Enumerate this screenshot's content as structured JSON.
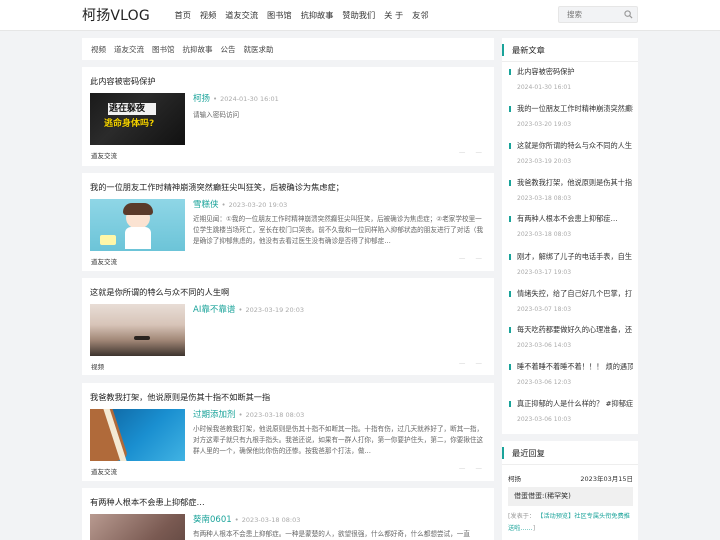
{
  "site": {
    "logo": "柯扬VLOG"
  },
  "nav": [
    "首页",
    "视频",
    "道友交流",
    "图书馆",
    "抗抑故事",
    "赞助我们",
    "关 于",
    "友邻"
  ],
  "search": {
    "placeholder": "搜索",
    "icon": "search-icon"
  },
  "categories": [
    "视频",
    "道友交流",
    "图书馆",
    "抗抑故事",
    "公告",
    "就医求助"
  ],
  "posts": [
    {
      "title": "此内容被密码保护",
      "author": "柯扬",
      "date": "2024-01-30 16:01",
      "excerpt": "请输入密码访问",
      "category": "道友交流",
      "thumb_text": [
        "逃在躲夜",
        "逃命身体吗?"
      ]
    },
    {
      "title": "我的一位朋友工作时精神崩溃突然癫狂尖叫狂笑，后被确诊为焦虑症；",
      "author": "雪糕侠",
      "date": "2023-03-20 19:03",
      "excerpt": "近期见闻：①我的一位朋友工作时精神崩溃突然癫狂尖叫狂笑，后被确诊为焦虑症；②老家学校里一位学生跳楼当场死亡，室长在校门口哭丧。前不久我和一位同样陷入抑郁状态的朋友进行了对话（我是确诊了抑郁焦虑的，他没有去看过医生没有确诊是否得了抑郁症…",
      "category": "道友交流"
    },
    {
      "title": "这就是你所谓的特么与众不同的人生啊",
      "author": "AI靠不靠谱",
      "date": "2023-03-19 20:03",
      "excerpt": "",
      "category": "视频"
    },
    {
      "title": "我爸教我打架，他说原则是伤其十指不如断其一指",
      "author": "过期添加剂",
      "date": "2023-03-18 08:03",
      "excerpt": "小时候我爸教我打架，他说原则是伤其十指不如断其一指。十指有伤，过几天就养好了，断其一指，对方这辈子就只有九根手指头。我爸还说，如果有一群人打你，第一你要护住头，第二，你要揪住这群人里的一个，确保他比你伤的还惨。按我爸那个打法，做…",
      "category": "道友交流"
    },
    {
      "title": "有两种人根本不会患上抑郁症…",
      "author": "葵南0601",
      "date": "2023-03-18 08:03",
      "excerpt": "有两种人根本不会患上抑郁症。一种是蒙楚的人，欲望很强，什么都好奇，什么都想尝试，一直",
      "category": ""
    }
  ],
  "sidebar": {
    "latest_title": "最新文章",
    "latest": [
      {
        "title": "此内容被密码保护",
        "date": "2024-01-30 16:01"
      },
      {
        "title": "我的一位朋友工作时精神崩溃突然癫狂",
        "date": "2023-03-20 19:03"
      },
      {
        "title": "这就是你所谓的特么与众不同的人生",
        "date": "2023-03-19 20:03"
      },
      {
        "title": "我爸教我打架，他说原则是伤其十指",
        "date": "2023-03-18 08:03"
      },
      {
        "title": "有两种人根本不会患上抑郁症…",
        "date": "2023-03-18 08:03"
      },
      {
        "title": "刚才，解绑了儿子的电话手表，自生",
        "date": "2023-03-17 19:03"
      },
      {
        "title": "情绪失控，给了自己好几个巴掌，打",
        "date": "2023-03-07 18:03"
      },
      {
        "title": "每天吃药都要做好久的心理准备，还",
        "date": "2023-03-06 14:03"
      },
      {
        "title": "睡不着睡不着睡不着！！！ 烦的遇顶",
        "date": "2023-03-06 12:03"
      },
      {
        "title": "真正抑郁的人是什么样的？ #抑郁症",
        "date": "2023-03-06 10:03"
      }
    ],
    "reply_title": "最近回复",
    "reply": {
      "user": "柯扬",
      "date": "2023年03月15日",
      "content": "借蛋借蛋:(稀罕笑)",
      "on_label": "[发表于：",
      "on_link": "【活动预览】社区专属头衔免费推送啦……",
      "on_end": "]"
    }
  },
  "colors": {
    "accent": "#1aa39a",
    "background": "#f2f3f5"
  }
}
